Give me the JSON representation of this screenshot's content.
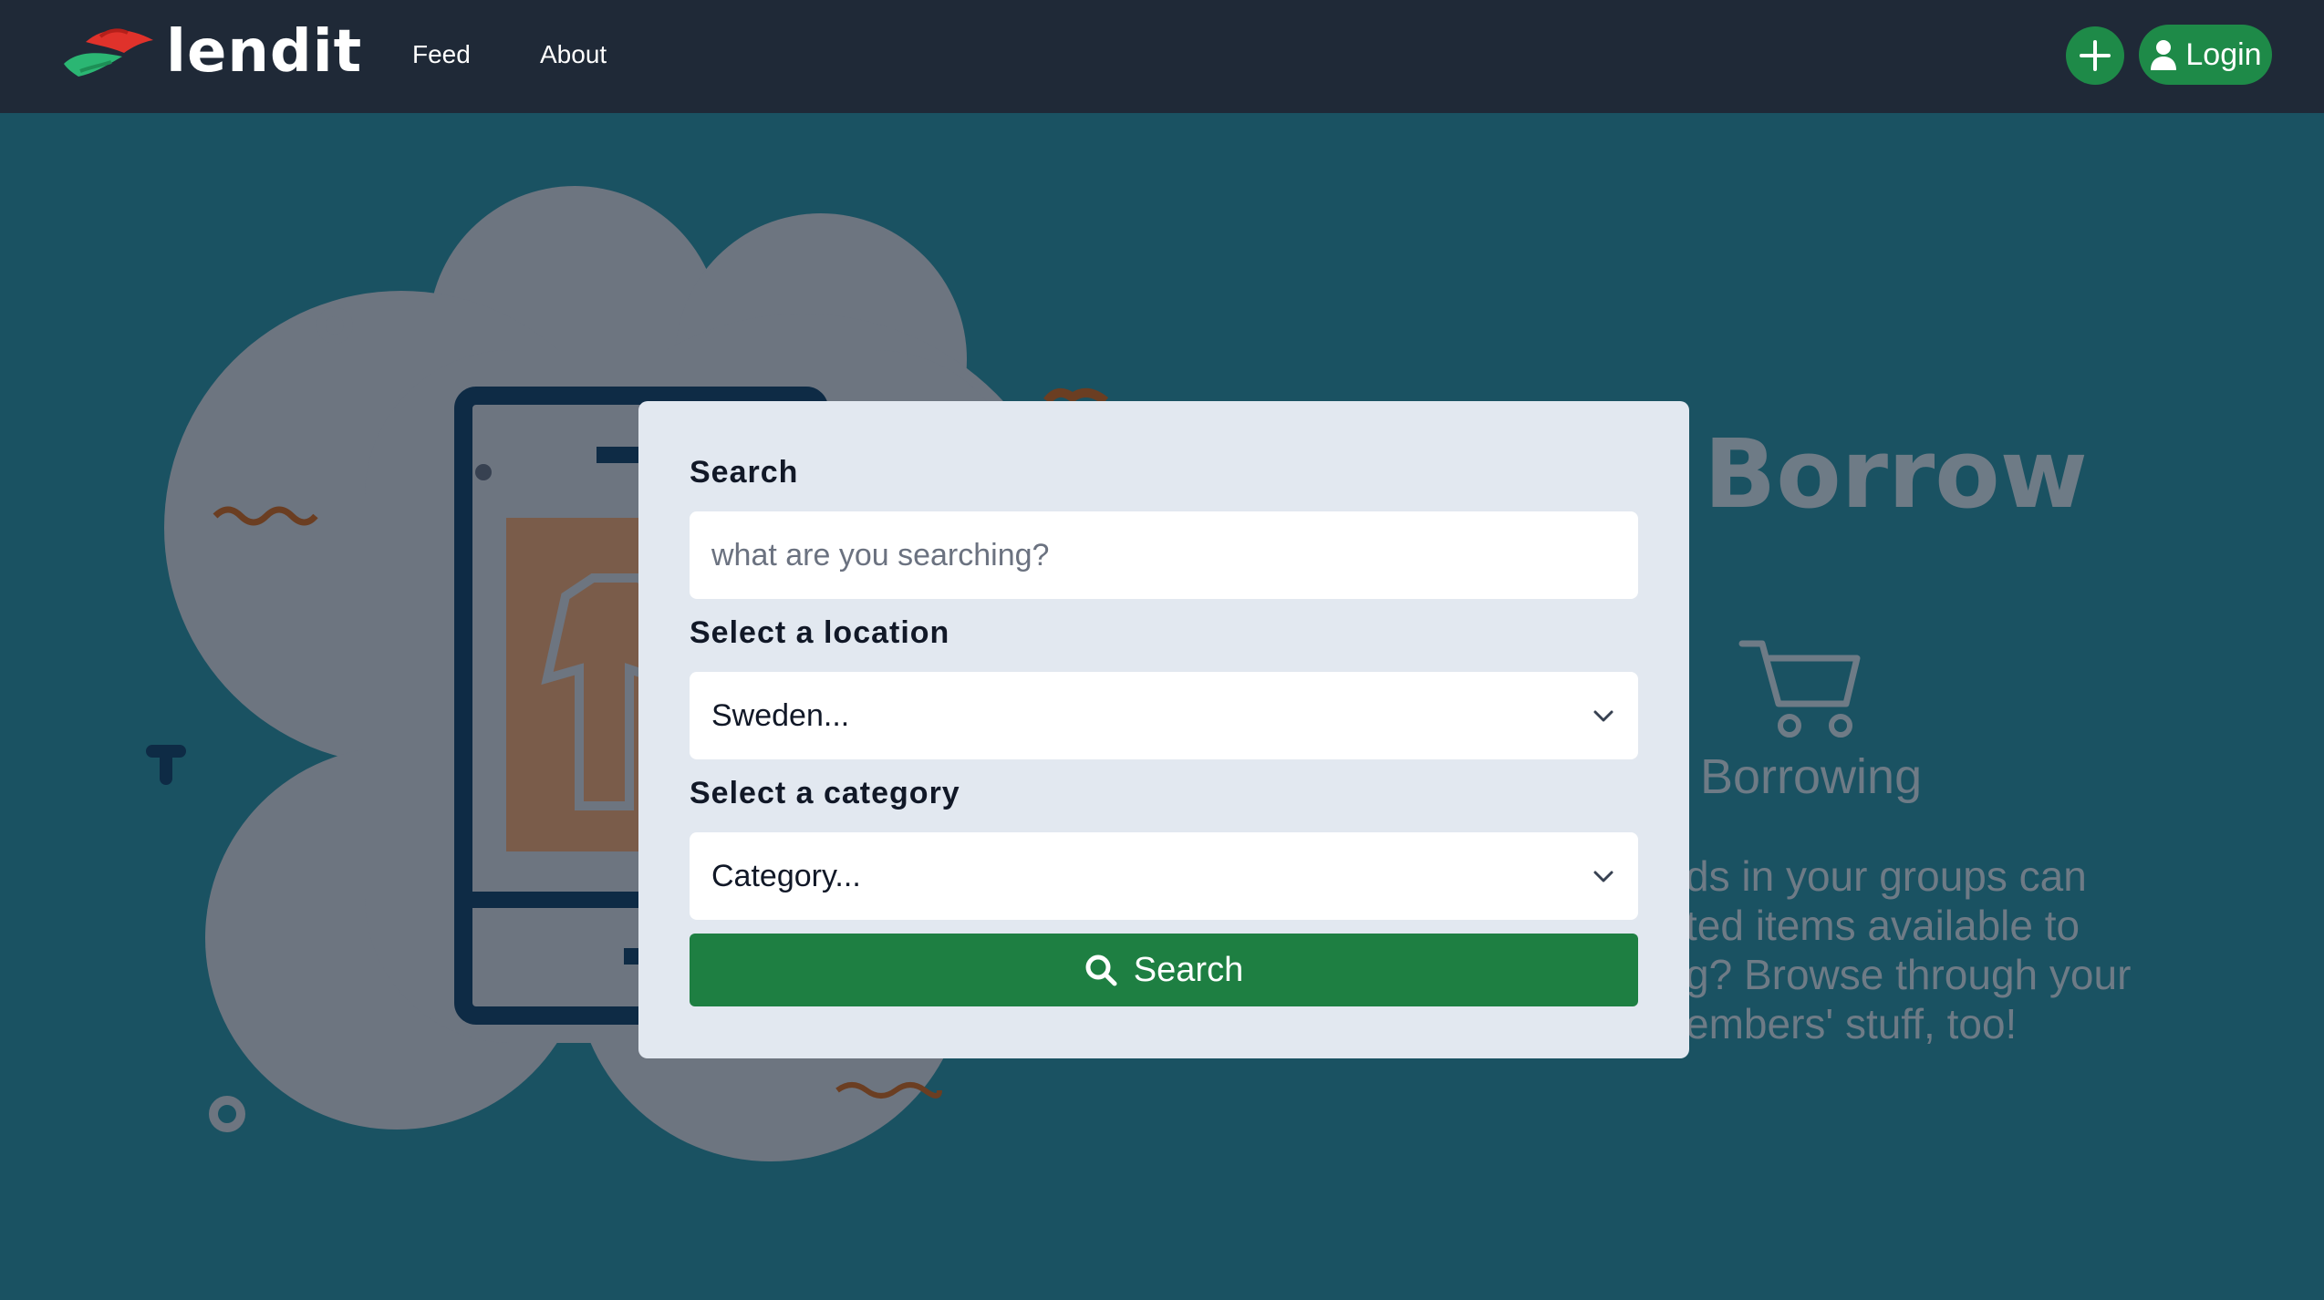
{
  "brand": {
    "name": "lendit"
  },
  "nav": {
    "feed": "Feed",
    "about": "About"
  },
  "header": {
    "login": "Login",
    "add_icon": "plus-icon",
    "user_icon": "user-icon"
  },
  "background": {
    "heading": "Borrow",
    "subheading": "Borrowing",
    "description_lines": [
      "ds in your groups can",
      "ted items available to",
      "g? Browse through your",
      "embers' stuff, too!"
    ]
  },
  "search_form": {
    "search_label": "Search",
    "search_placeholder": "what are you searching?",
    "location_label": "Select a location",
    "location_value": "Sweden...",
    "category_label": "Select a category",
    "category_value": "Category...",
    "submit_label": "Search"
  },
  "colors": {
    "navbar": "#1f2937",
    "page_background": "#1a5262",
    "accent_green": "#1e7f42",
    "card": "#e2e8f0"
  }
}
